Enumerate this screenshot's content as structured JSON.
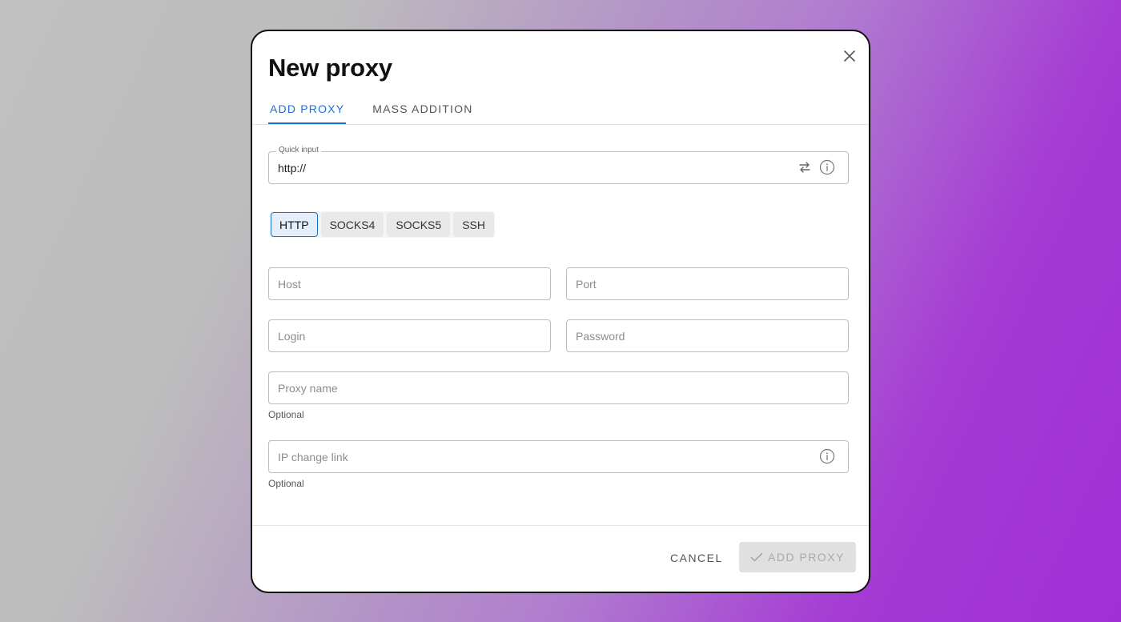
{
  "dialog": {
    "title": "New proxy",
    "close_icon": "close-icon"
  },
  "tabs": [
    {
      "label": "ADD PROXY",
      "active": true
    },
    {
      "label": "MASS ADDITION",
      "active": false
    }
  ],
  "quick_input": {
    "legend": "Quick input",
    "value": "http://",
    "icons": [
      "swap-arrows-icon",
      "info-icon"
    ]
  },
  "proxy_types": [
    {
      "label": "HTTP",
      "selected": true
    },
    {
      "label": "SOCKS4",
      "selected": false
    },
    {
      "label": "SOCKS5",
      "selected": false
    },
    {
      "label": "SSH",
      "selected": false
    }
  ],
  "fields": {
    "host": {
      "placeholder": "Host"
    },
    "port": {
      "placeholder": "Port"
    },
    "login": {
      "placeholder": "Login"
    },
    "password": {
      "placeholder": "Password"
    },
    "proxy_name": {
      "placeholder": "Proxy name",
      "helper": "Optional"
    },
    "ip_change_link": {
      "placeholder": "IP change link",
      "helper": "Optional",
      "icon": "info-icon"
    }
  },
  "footer": {
    "cancel_label": "CANCEL",
    "add_label": "ADD PROXY",
    "add_icon": "check-icon"
  },
  "colors": {
    "accent": "#1f6fd1",
    "disabled_bg": "#e0e0e0",
    "disabled_text": "#a9a9a9"
  }
}
